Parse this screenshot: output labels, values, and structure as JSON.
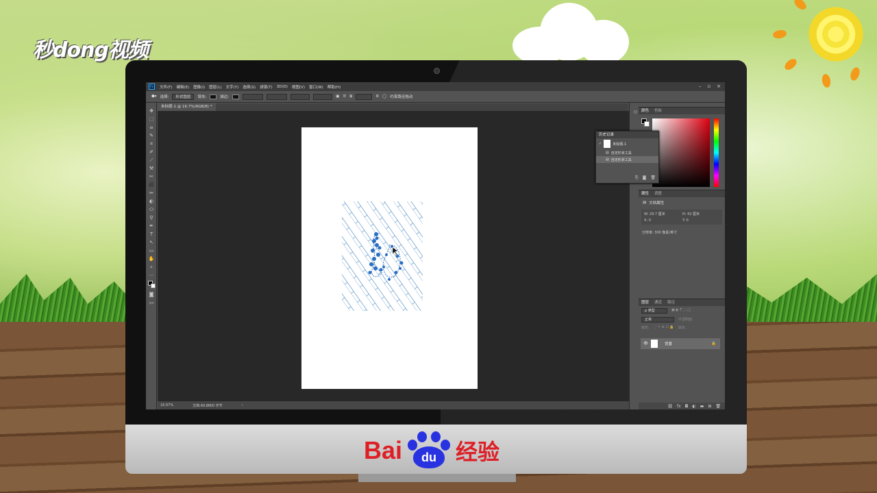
{
  "watermark": {
    "brand": "秒dong视频"
  },
  "footer_logo": {
    "bai": "Bai",
    "du": "du",
    "jingyan": "经验"
  },
  "photoshop": {
    "app_icon": "Ps",
    "menus": [
      "文件(F)",
      "编辑(E)",
      "图像(I)",
      "图层(L)",
      "文字(Y)",
      "选择(S)",
      "滤镜(T)",
      "3D(D)",
      "视图(V)",
      "窗口(W)",
      "帮助(H)"
    ],
    "window_controls": [
      "–",
      "▫",
      "×"
    ],
    "options": {
      "mode_label": "选择:",
      "mode_value": "形状图层",
      "fill_label": "填充:",
      "stroke_label": "描边:",
      "constrain_label": "约束路径拖动"
    },
    "document_tab": "未标题-1 @ 16.7%(RGB/8) *",
    "tools": [
      "✥",
      "⬚",
      "ⴰ",
      "✎",
      "⌗",
      "✐",
      "⟋",
      "⚒",
      "✂",
      "⬛",
      "✏",
      "◐",
      "⬭",
      "⚲",
      "✒",
      "T",
      "↖",
      "▭",
      "✋",
      "⌕",
      "⋯"
    ],
    "status": {
      "zoom": "16.67%",
      "doc": "文档:49.8M/0 字节",
      "arrow": "›"
    },
    "panels": {
      "color_tabs": [
        "颜色",
        "色板"
      ],
      "history": {
        "title": "历史记录",
        "snapshot": "未标题-1",
        "items": [
          "自定形状工具",
          "自定形状工具"
        ]
      },
      "properties_tabs": [
        "属性",
        "调整"
      ],
      "properties_title": "文档属性",
      "props": {
        "w": "W: 29.7 厘米",
        "h": "H: 42 厘米",
        "x": "X: 0",
        "y": "Y: 0",
        "resolution": "分辨率: 300 像素/英寸"
      },
      "layers_tabs": [
        "图层",
        "通道",
        "路径"
      ],
      "layers_kind": "ρ 类型",
      "layers_blend": "正常",
      "layers_opacity": "不透明度:",
      "layers_lock": "锁定:",
      "layers_fill": "填充:",
      "layer_name": "背景"
    }
  }
}
